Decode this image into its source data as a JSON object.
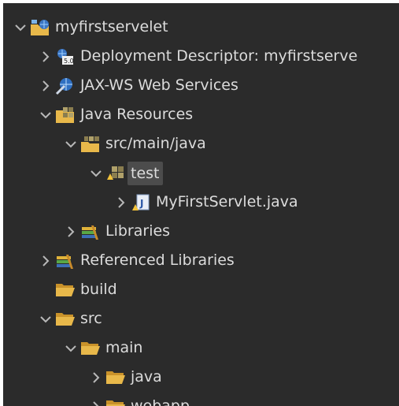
{
  "tree": {
    "rows": [
      {
        "label": "myfirstservelet",
        "indent": 0,
        "expanded": true,
        "hasChevron": true,
        "icon": "web-project-icon"
      },
      {
        "label": "Deployment Descriptor: myfirstserve",
        "indent": 1,
        "expanded": false,
        "hasChevron": true,
        "icon": "deployment-descriptor-icon"
      },
      {
        "label": "JAX-WS Web Services",
        "indent": 1,
        "expanded": false,
        "hasChevron": true,
        "icon": "web-services-icon"
      },
      {
        "label": "Java Resources",
        "indent": 1,
        "expanded": true,
        "hasChevron": true,
        "icon": "java-resources-icon"
      },
      {
        "label": "src/main/java",
        "indent": 2,
        "expanded": true,
        "hasChevron": true,
        "icon": "source-folder-icon"
      },
      {
        "label": "test",
        "indent": 3,
        "expanded": true,
        "hasChevron": true,
        "icon": "package-icon",
        "selected": true
      },
      {
        "label": "MyFirstServlet.java",
        "indent": 4,
        "expanded": false,
        "hasChevron": true,
        "icon": "java-file-icon"
      },
      {
        "label": "Libraries",
        "indent": 2,
        "expanded": false,
        "hasChevron": true,
        "icon": "libraries-icon"
      },
      {
        "label": "Referenced Libraries",
        "indent": 1,
        "expanded": false,
        "hasChevron": true,
        "icon": "libraries-icon"
      },
      {
        "label": "build",
        "indent": 1,
        "expanded": false,
        "hasChevron": false,
        "icon": "folder-icon"
      },
      {
        "label": "src",
        "indent": 1,
        "expanded": true,
        "hasChevron": true,
        "icon": "folder-icon"
      },
      {
        "label": "main",
        "indent": 2,
        "expanded": true,
        "hasChevron": true,
        "icon": "folder-icon"
      },
      {
        "label": "java",
        "indent": 3,
        "expanded": false,
        "hasChevron": true,
        "icon": "folder-icon"
      },
      {
        "label": "webapp",
        "indent": 3,
        "expanded": false,
        "hasChevron": true,
        "icon": "folder-icon"
      }
    ]
  },
  "colors": {
    "background": "#2b2b2b",
    "text": "#dcdcdc",
    "selection": "#4c4c4c",
    "folder": "#e8b84a",
    "chevron": "#b8b8b8"
  }
}
